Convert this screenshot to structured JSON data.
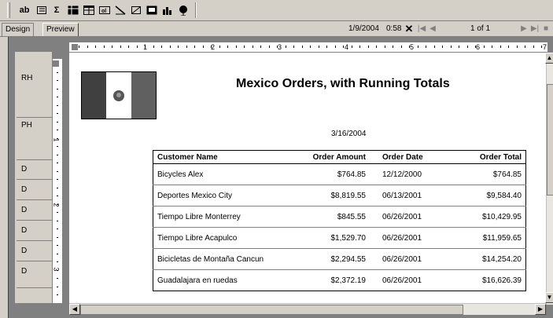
{
  "toolbar": {
    "icons": [
      "text-field-icon",
      "list-icon",
      "sum-icon",
      "cross-tab-icon",
      "table-icon",
      "ole-object-icon",
      "line-icon",
      "box-icon",
      "picture-icon",
      "chart-icon",
      "map-icon"
    ],
    "text_field_label": "ab",
    "sum_label": "Σ"
  },
  "navbar": {
    "tabs": [
      "Design",
      "Preview"
    ],
    "active_tab": "Preview",
    "date": "1/9/2004",
    "time": "0:58",
    "page_indicator": "1 of 1"
  },
  "ruler": {
    "top_numbers": [
      "1",
      "2",
      "3",
      "4",
      "5",
      "6",
      "7"
    ],
    "left_numbers": [
      "1",
      "2",
      "3"
    ]
  },
  "sections": [
    "RH",
    "PH",
    "D",
    "D",
    "D",
    "D",
    "D",
    "D"
  ],
  "report": {
    "title": "Mexico Orders, with Running Totals",
    "date": "3/16/2004",
    "columns": [
      "Customer Name",
      "Order Amount",
      "Order Date",
      "Order Total"
    ],
    "rows": [
      [
        "Bicycles Alex",
        "$764.85",
        "12/12/2000",
        "$764.85"
      ],
      [
        "Deportes Mexico City",
        "$8,819.55",
        "06/13/2001",
        "$9,584.40"
      ],
      [
        "Tiempo Libre Monterrey",
        "$845.55",
        "06/26/2001",
        "$10,429.95"
      ],
      [
        "Tiempo Libre Acapulco",
        "$1,529.70",
        "06/26/2001",
        "$11,959.65"
      ],
      [
        "Bicicletas  de Montaña Cancun",
        "$2,294.55",
        "06/26/2001",
        "$14,254.20"
      ],
      [
        "Guadalajara en ruedas",
        "$2,372.19",
        "06/26/2001",
        "$16,626.39"
      ]
    ],
    "flag_colors": [
      "#006847",
      "#ffffff",
      "#ce1126"
    ]
  }
}
